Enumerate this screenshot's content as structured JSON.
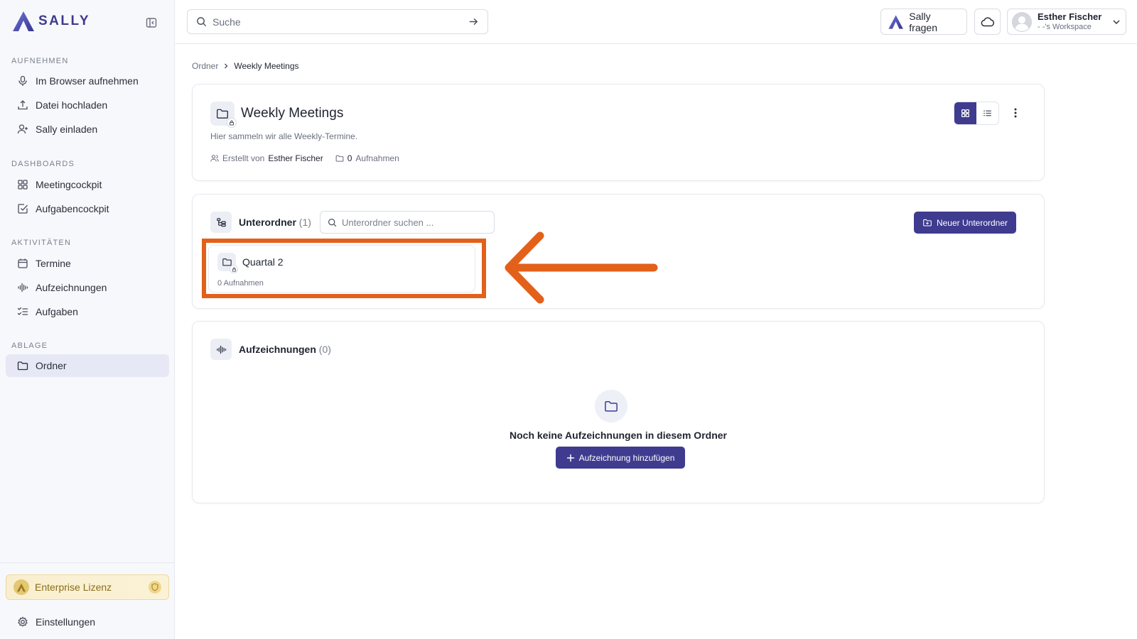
{
  "app": {
    "name": "SALLY"
  },
  "sidebar": {
    "sections": [
      {
        "label": "AUFNEHMEN",
        "items": [
          {
            "label": "Im Browser aufnehmen",
            "icon": "mic-icon"
          },
          {
            "label": "Datei hochladen",
            "icon": "upload-icon"
          },
          {
            "label": "Sally einladen",
            "icon": "user-plus-icon"
          }
        ]
      },
      {
        "label": "DASHBOARDS",
        "items": [
          {
            "label": "Meetingcockpit",
            "icon": "grid-icon"
          },
          {
            "label": "Aufgabencockpit",
            "icon": "checkbox-icon"
          }
        ]
      },
      {
        "label": "AKTIVITÄTEN",
        "items": [
          {
            "label": "Termine",
            "icon": "calendar-icon"
          },
          {
            "label": "Aufzeichnungen",
            "icon": "waveform-icon"
          },
          {
            "label": "Aufgaben",
            "icon": "tasklist-icon"
          }
        ]
      },
      {
        "label": "ABLAGE",
        "items": [
          {
            "label": "Ordner",
            "icon": "folder-icon",
            "active": true
          }
        ]
      }
    ],
    "license_label": "Enterprise Lizenz",
    "settings_label": "Einstellungen"
  },
  "topbar": {
    "search_placeholder": "Suche",
    "ask_label": "Sally fragen",
    "user_name": "Esther Fischer",
    "workspace": "- -'s Workspace"
  },
  "breadcrumb": {
    "root": "Ordner",
    "current": "Weekly Meetings"
  },
  "folder": {
    "title": "Weekly Meetings",
    "description": "Hier sammeln wir alle Weekly-Termine.",
    "created_by_label": "Erstellt von",
    "created_by": "Esther Fischer",
    "recordings_count": "0",
    "recordings_label": "Aufnahmen"
  },
  "subfolders": {
    "title": "Unterordner",
    "count": "(1)",
    "search_placeholder": "Unterordner suchen ...",
    "new_button": "Neuer Unterordner",
    "items": [
      {
        "name": "Quartal 2",
        "count": "0 Aufnahmen"
      }
    ]
  },
  "recordings": {
    "title": "Aufzeichnungen",
    "count": "(0)",
    "empty_text": "Noch keine Aufzeichnungen in diesem Ordner",
    "add_button": "Aufzeichnung hinzufügen"
  },
  "colors": {
    "accent": "#3f3b8f",
    "highlight": "#e3601b"
  }
}
